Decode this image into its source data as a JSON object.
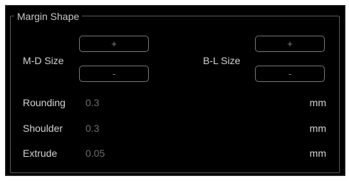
{
  "group": {
    "title": "Margin Shape"
  },
  "md_size": {
    "label": "M-D Size",
    "plus_label": "+",
    "minus_label": "-"
  },
  "bl_size": {
    "label": "B-L Size",
    "plus_label": "+",
    "minus_label": "-"
  },
  "rows": [
    {
      "label": "Rounding",
      "value": "0.3",
      "unit": "mm"
    },
    {
      "label": "Shoulder",
      "value": "0.3",
      "unit": "mm"
    },
    {
      "label": "Extrude",
      "value": "0.05",
      "unit": "mm"
    }
  ],
  "colors": {
    "background": "#000000",
    "label_text": "#d4d4d4",
    "value_text": "#6e6e6e",
    "button_border": "#777777"
  }
}
